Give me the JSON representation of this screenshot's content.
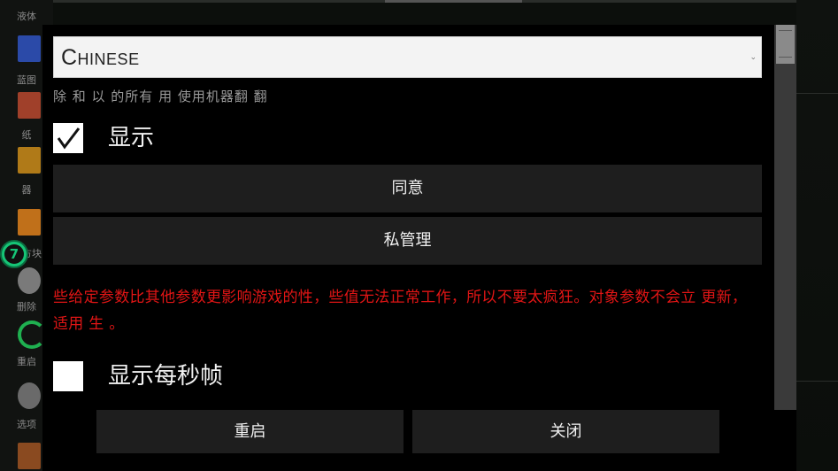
{
  "background_sidebar": {
    "items": [
      {
        "label": "液体",
        "color": "#5a5a5a"
      },
      {
        "label": "蓝图",
        "color": "#2b4aa8"
      },
      {
        "label": "纸",
        "color": "#a0402a"
      },
      {
        "label": "器",
        "color": "#b07a18"
      },
      {
        "label": "方块",
        "color": "#c0701a"
      },
      {
        "label": "删除",
        "color": "#7a7a7a"
      },
      {
        "label": "重启",
        "color": "#1fb050"
      },
      {
        "label": "选项",
        "color": "#6a6a6a"
      }
    ]
  },
  "dialog": {
    "language_select": {
      "value": "Chinese"
    },
    "translation_hint": "除 和 以 的所有 用  使用机器翻 翻",
    "show_checkbox": {
      "label": "显示",
      "checked": true
    },
    "agree_button": "同意",
    "privacy_button": "私管理",
    "warning": "些给定参数比其他参数更影响游戏的性，些值无法正常工作，所以不要太疯狂。对象参数不会立 更新， 适用 生 。",
    "fps_checkbox": {
      "label": "显示每秒帧",
      "checked": false
    }
  },
  "footer": {
    "restart_button": "重启",
    "close_button": "关闭"
  },
  "colors": {
    "warning": "#e01515",
    "fab": "#16c476"
  }
}
